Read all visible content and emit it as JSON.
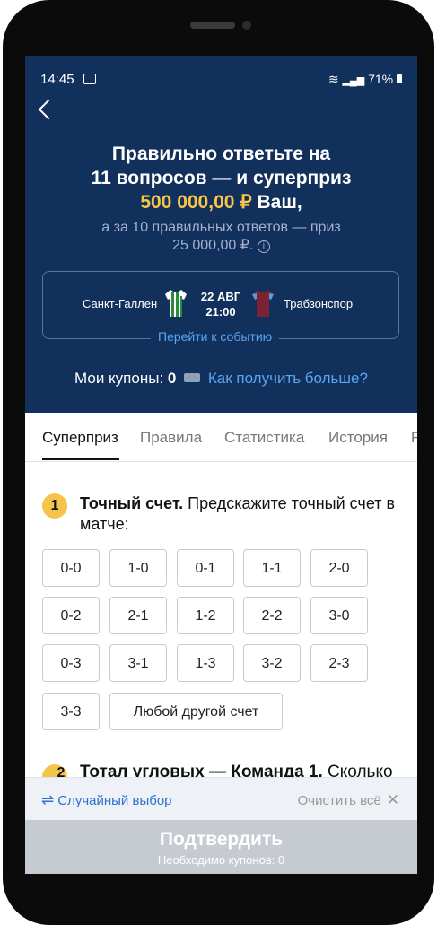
{
  "status_bar": {
    "time": "14:45",
    "battery": "71%"
  },
  "header": {
    "title_line1": "Правильно ответьте на",
    "title_line2": "11 вопросов — и суперприз",
    "amount": "500 000,00 ₽",
    "amount_suffix": " Ваш,",
    "subtitle_line1": "а за 10 правильных ответов — приз",
    "subtitle_line2": "25 000,00 ₽.",
    "accent_color": "#f9c648",
    "background_color": "#12305c"
  },
  "event": {
    "team_home": "Санкт-Галлен",
    "date": "22 АВГ",
    "time": "21:00",
    "team_away": "Трабзонспор",
    "link": "Перейти к событию"
  },
  "coupons": {
    "label": "Мои купоны:",
    "count": "0",
    "link": "Как получить больше?"
  },
  "tabs": [
    "Суперприз",
    "Правила",
    "Статистика",
    "История",
    "F"
  ],
  "question1": {
    "number": "1",
    "title": "Точный счет.",
    "text": " Предскажите точный счет в матче:",
    "options": [
      "0-0",
      "1-0",
      "0-1",
      "1-1",
      "2-0",
      "0-2",
      "2-1",
      "1-2",
      "2-2",
      "3-0",
      "0-3",
      "3-1",
      "1-3",
      "3-2",
      "2-3",
      "3-3",
      "Любой другой счет"
    ]
  },
  "question2": {
    "number": "2",
    "title": "Тотал угловых — Команда 1.",
    "text": " Сколько"
  },
  "bottom": {
    "random": "Случайный выбор",
    "clear": "Очистить всё"
  },
  "confirm": {
    "title": "Подтвердить",
    "subtitle": "Необходимо купонов: 0"
  }
}
